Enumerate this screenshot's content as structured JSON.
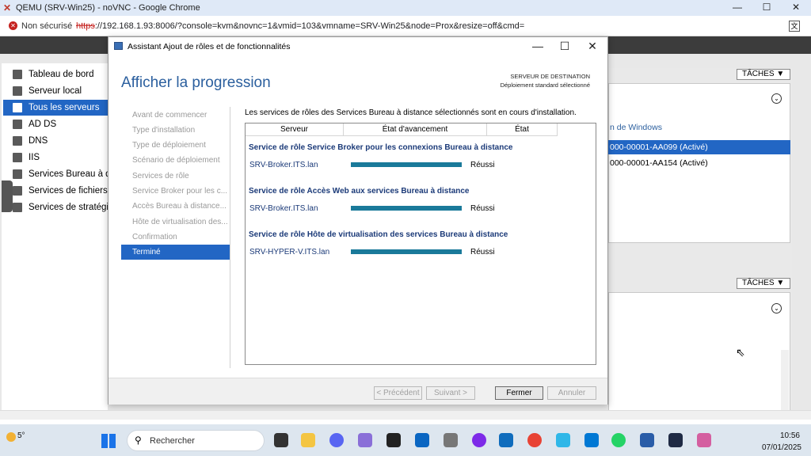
{
  "chrome": {
    "title": "QEMU (SRV-Win25) - noVNC - Google Chrome",
    "not_secure": "Non sécurisé",
    "url_scheme": "https",
    "url_rest": "://192.168.1.93:8006/?console=kvm&novnc=1&vmid=103&vmname=SRV-Win25&node=Prox&resize=off&cmd="
  },
  "nav": {
    "items": [
      "Tableau de bord",
      "Serveur local",
      "Tous les serveurs",
      "AD DS",
      "DNS",
      "IIS",
      "Services Bureau à dis",
      "Services de fichiers e",
      "Services de stratégie"
    ],
    "selected_index": 2
  },
  "right": {
    "taches1": "TÂCHES ▼",
    "taches2": "TÂCHES ▼",
    "col_header": "n de Windows",
    "row1": "000-00001-AA099 (Activé)",
    "row2": "000-00001-AA154 (Activé)"
  },
  "dialog": {
    "title": "Assistant Ajout de rôles et de fonctionnalités",
    "heading": "Afficher la progression",
    "dest_label": "SERVEUR DE DESTINATION",
    "dest_value": "Déploiement standard sélectionné",
    "steps": [
      "Avant de commencer",
      "Type d'installation",
      "Type de déploiement",
      "Scénario de déploiement",
      "Services de rôle",
      "Service Broker pour les c...",
      "Accès Bureau à distance...",
      "Hôte de virtualisation des...",
      "Confirmation",
      "Terminé"
    ],
    "selected_step": 9,
    "intro": "Les services de rôles des Services Bureau à distance sélectionnés sont en cours d'installation.",
    "columns": [
      "Serveur",
      "État d'avancement",
      "État"
    ],
    "groups": [
      {
        "title": "Service de rôle Service Broker pour les connexions Bureau à distance",
        "server": "SRV-Broker.ITS.lan",
        "progress": 1.0,
        "status": "Réussi"
      },
      {
        "title": "Service de rôle Accès Web aux services Bureau à distance",
        "server": "SRV-Broker.ITS.lan",
        "progress": 1.0,
        "status": "Réussi"
      },
      {
        "title": "Service de rôle Hôte de virtualisation des services Bureau à distance",
        "server": "SRV-HYPER-V.ITS.lan",
        "progress": 1.0,
        "status": "Réussi"
      }
    ],
    "buttons": {
      "prev": "< Précédent",
      "next": "Suivant >",
      "close": "Fermer",
      "cancel": "Annuler"
    }
  },
  "taskbar": {
    "temp": "5°",
    "search": "Rechercher",
    "time": "10:56",
    "date": "07/01/2025"
  }
}
